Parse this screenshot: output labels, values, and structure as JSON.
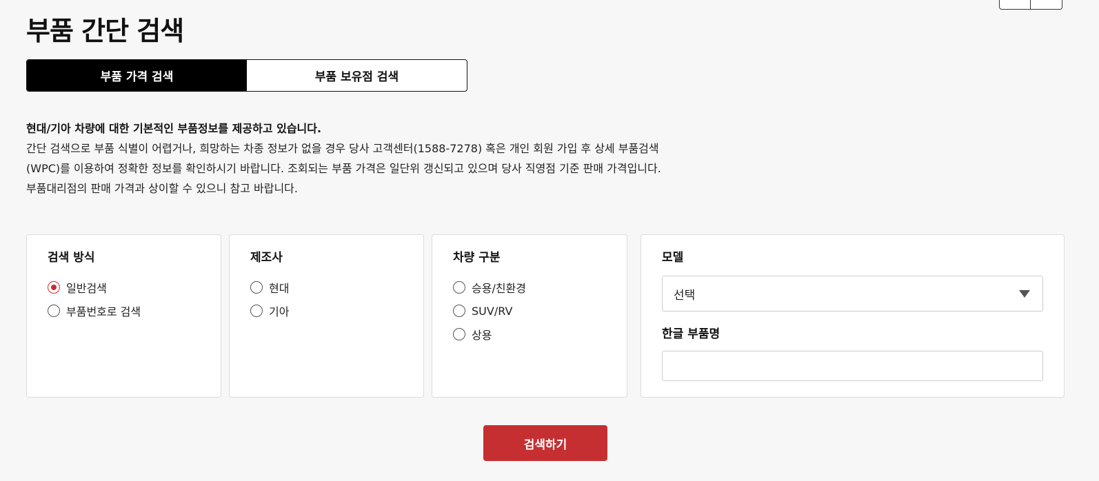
{
  "page": {
    "title": "부품 간단 검색"
  },
  "tabs": [
    {
      "label": "부품 가격 검색",
      "active": true
    },
    {
      "label": "부품 보유점 검색",
      "active": false
    }
  ],
  "intro": {
    "lead": "현대/기아 차량에 대한 기본적인 부품정보를 제공하고 있습니다.",
    "lines": [
      "간단 검색으로 부품 식별이 어렵거나, 희망하는 차종 정보가 없을 경우 당사 고객센터(1588-7278) 혹은 개인 회원 가입 후 상세 부품검색",
      "(WPC)를 이용하여 정확한 정보를 확인하시기 바랍니다. 조회되는 부품 가격은 일단위 갱신되고 있으며 당사 직영점 기준 판매 가격입니다.",
      "부품대리점의 판매 가격과 상이할 수 있으니 참고 바랍니다."
    ]
  },
  "search_method": {
    "title": "검색 방식",
    "options": [
      {
        "label": "일반검색",
        "checked": true
      },
      {
        "label": "부품번호로 검색",
        "checked": false
      }
    ]
  },
  "manufacturer": {
    "title": "제조사",
    "options": [
      {
        "label": "현대",
        "checked": false
      },
      {
        "label": "기아",
        "checked": false
      }
    ]
  },
  "vehicle_type": {
    "title": "차량 구분",
    "options": [
      {
        "label": "승용/친환경",
        "checked": false
      },
      {
        "label": "SUV/RV",
        "checked": false
      },
      {
        "label": "상용",
        "checked": false
      }
    ]
  },
  "model": {
    "title": "모델",
    "selected": "선택",
    "part_name_label": "한글 부품명",
    "part_name_value": ""
  },
  "actions": {
    "search_label": "검색하기"
  },
  "colors": {
    "accent": "#c62f32",
    "tab_active_bg": "#000000"
  }
}
